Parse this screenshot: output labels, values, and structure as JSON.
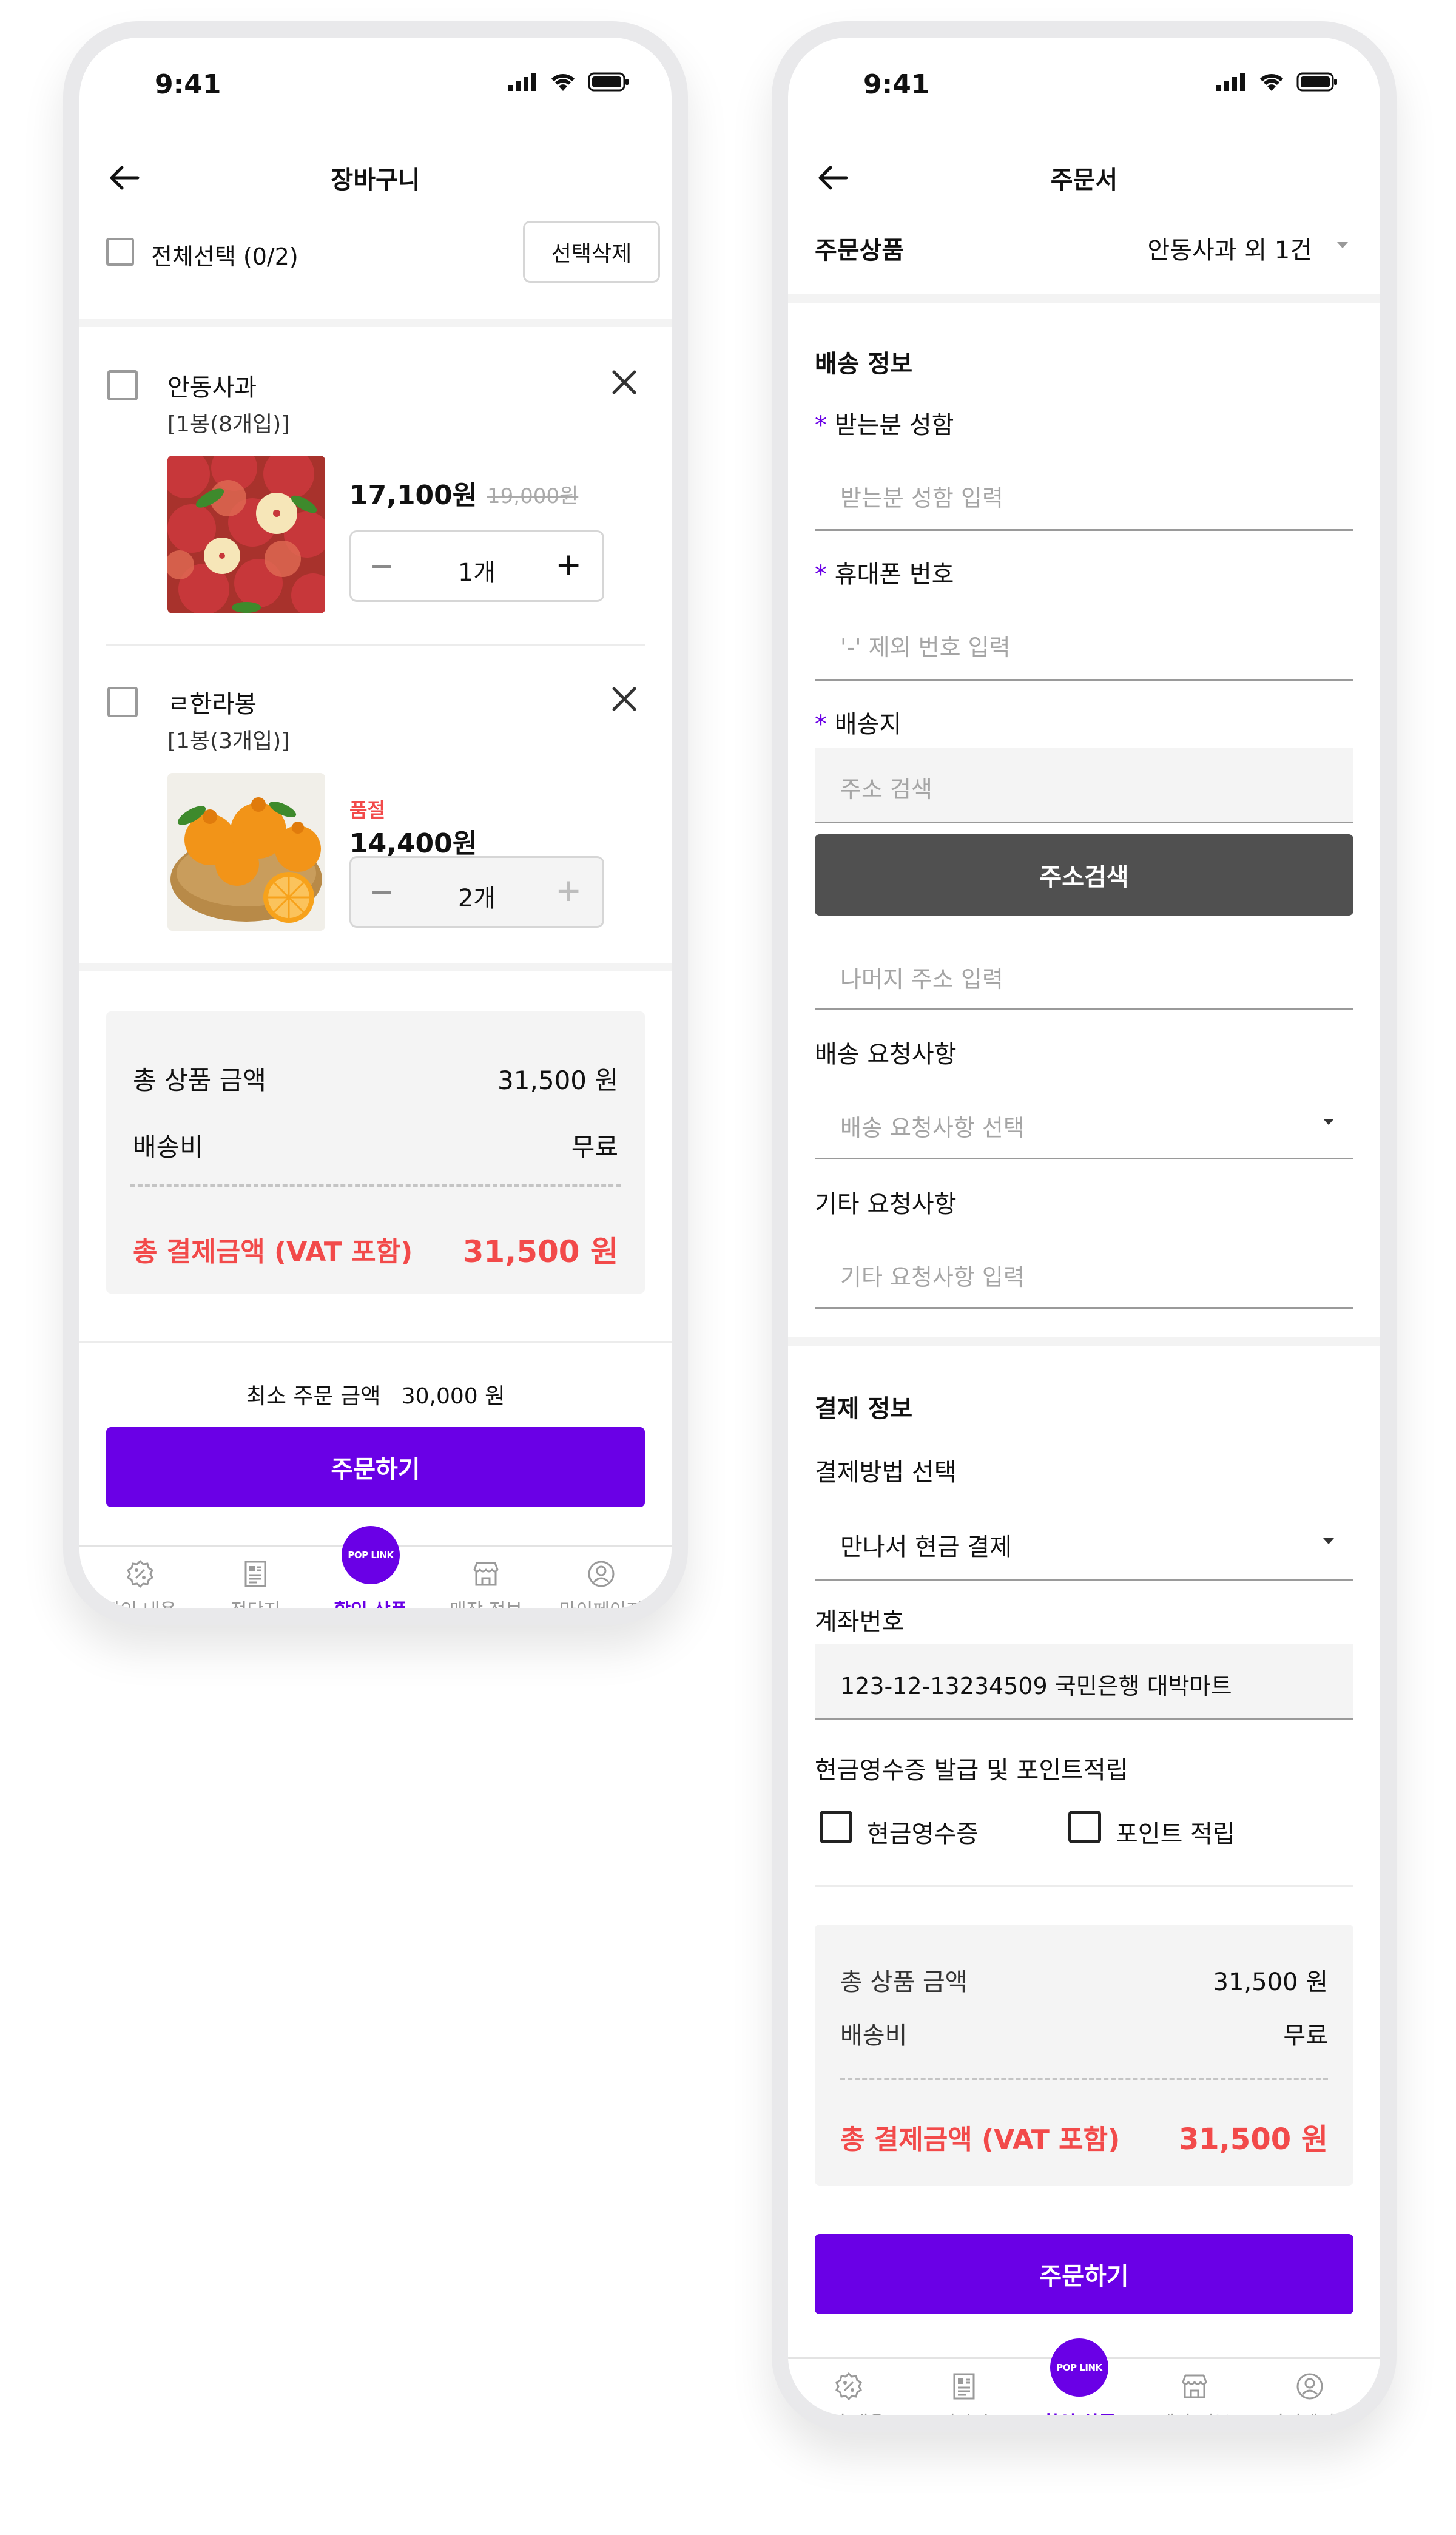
{
  "status": {
    "time": "9:41"
  },
  "cart": {
    "title": "장바구니",
    "select_all": "전체선택 (0/2)",
    "delete_selected": "선택삭제",
    "items": [
      {
        "name": "안동사과",
        "option": "[1봉(8개입)]",
        "price": "17,100원",
        "original_price": "19,000원",
        "quantity": "1개",
        "status": "",
        "image": "apples"
      },
      {
        "name": "ㄹ한라봉",
        "option": "[1봉(3개입)]",
        "price": "14,400원",
        "original_price": "",
        "quantity": "2개",
        "status": "품절",
        "image": "hallabong"
      }
    ],
    "summary": {
      "total_label": "총 상품 금액",
      "total_value": "31,500 원",
      "shipping_label": "배송비",
      "shipping_value": "무료",
      "grand_label": "총 결제금액 (VAT 포함)",
      "grand_value": "31,500 원"
    },
    "min_order_label": "최소 주문 금액",
    "min_order_value": "30,000 원",
    "order_button": "주문하기"
  },
  "order": {
    "title": "주문서",
    "products_label": "주문상품",
    "products_value": "안동사과 외 1건",
    "delivery": {
      "section_title": "배송 정보",
      "recipient_label": "받는분 성함",
      "recipient_placeholder": "받는분 성함 입력",
      "phone_label": "휴대폰 번호",
      "phone_placeholder": "'-' 제외 번호 입력",
      "address_label": "배송지",
      "address_placeholder": "주소 검색",
      "address_search_button": "주소검색",
      "address_detail_placeholder": "나머지 주소 입력",
      "request_label": "배송 요청사항",
      "request_placeholder": "배송 요청사항 선택",
      "etc_label": "기타 요청사항",
      "etc_placeholder": "기타 요청사항 입력"
    },
    "payment": {
      "section_title": "결제 정보",
      "method_label": "결제방법 선택",
      "method_value": "만나서 현금 결제",
      "account_label": "계좌번호",
      "account_value": "123-12-13234509 국민은행 대박마트",
      "receipt_label": "현금영수증 발급 및 포인트적립",
      "receipt_option": "현금영수증",
      "points_option": "포인트 적립"
    },
    "summary": {
      "total_label": "총 상품 금액",
      "total_value": "31,500 원",
      "shipping_label": "배송비",
      "shipping_value": "무료",
      "grand_label": "총 결제금액 (VAT 포함)",
      "grand_value": "31,500 원"
    },
    "order_button": "주문하기"
  },
  "tabbar": {
    "items": [
      {
        "label": "할인 내용",
        "icon": "discount-icon"
      },
      {
        "label": "전단지",
        "icon": "flyer-icon"
      },
      {
        "label": "할인 상품",
        "icon": "pop-link-icon",
        "badge": "POP LINK",
        "active": true
      },
      {
        "label": "매장 정보",
        "icon": "store-icon"
      },
      {
        "label": "마이페이지",
        "icon": "user-icon"
      }
    ]
  },
  "colors": {
    "accent": "#6a00e6",
    "sale_red": "#f24a4a",
    "dark_button": "#505050"
  }
}
